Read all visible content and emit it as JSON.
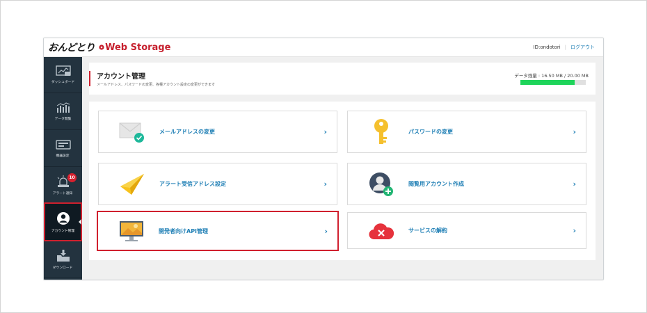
{
  "header": {
    "logo_ondotori": "おんどとり",
    "logo_web": "Web Storage",
    "user_id": "ID:ondotori",
    "separator": "|",
    "logout": "ログアウト"
  },
  "sidebar": {
    "items": [
      {
        "label": "ダッシュボード",
        "icon": "dashboard-icon"
      },
      {
        "label": "データ閲覧",
        "icon": "data-view-icon"
      },
      {
        "label": "機器設定",
        "icon": "device-settings-icon"
      },
      {
        "label": "アラート通知",
        "icon": "alert-lamp-icon",
        "badge": "10"
      },
      {
        "label": "アカウント管理",
        "icon": "account-icon",
        "active": true
      },
      {
        "label": "ダウンロード",
        "icon": "download-icon"
      }
    ]
  },
  "page": {
    "title": "アカウント管理",
    "description": "メールアドレス、パスワードの変更、各種アカウント設定の変更ができます",
    "storage_text": "データ残量 : 16.50 MB / 20.00 MB",
    "storage_used_fraction": 0.825,
    "storage_color": "#1ed45a"
  },
  "cards": [
    {
      "label": "メールアドレスの変更",
      "arrow": "›",
      "icon": "envelope-check-icon"
    },
    {
      "label": "パスワードの変更",
      "arrow": "›",
      "icon": "key-icon"
    },
    {
      "label": "アラート受信アドレス設定",
      "arrow": "›",
      "icon": "paper-plane-icon"
    },
    {
      "label": "閲覧用アカウント作成",
      "arrow": "›",
      "icon": "add-user-icon"
    },
    {
      "label": "開発者向けAPI管理",
      "arrow": "›",
      "icon": "monitor-api-icon",
      "highlighted": true
    },
    {
      "label": "サービスの解約",
      "arrow": "›",
      "icon": "cloud-cancel-icon"
    }
  ],
  "colors": {
    "accent_red": "#d0202e",
    "link_blue": "#1f7fb5",
    "sidebar_bg": "#23333f"
  }
}
